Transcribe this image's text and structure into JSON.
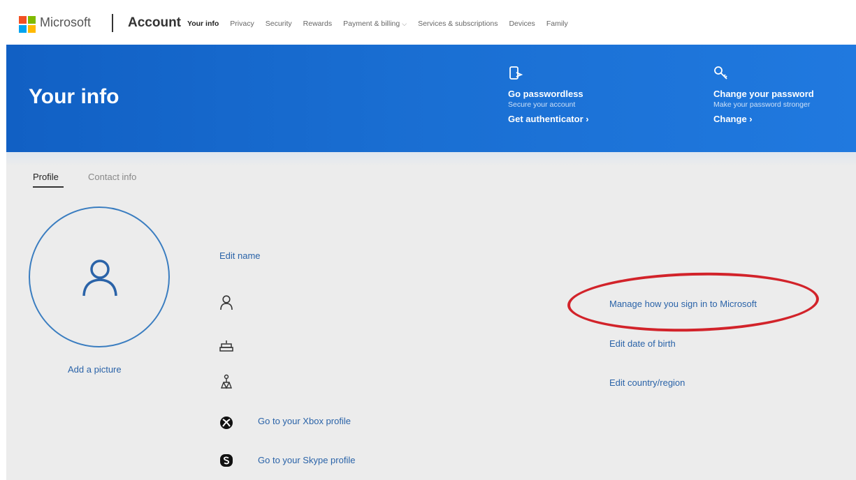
{
  "header": {
    "brand": "Microsoft",
    "product": "Account",
    "nav": [
      {
        "label": "Your info",
        "active": true
      },
      {
        "label": "Privacy"
      },
      {
        "label": "Security"
      },
      {
        "label": "Rewards"
      },
      {
        "label": "Payment & billing",
        "has_dropdown": true
      },
      {
        "label": "Services & subscriptions"
      },
      {
        "label": "Devices"
      },
      {
        "label": "Family"
      }
    ],
    "dropdown_glyph": "⌵"
  },
  "banner": {
    "title": "Your info",
    "promos": [
      {
        "icon": "passwordless-phone-icon",
        "title": "Go passwordless",
        "subtitle": "Secure your account",
        "link": "Get authenticator ›"
      },
      {
        "icon": "key-icon",
        "title": "Change your password",
        "subtitle": "Make your password stronger",
        "link": "Change ›"
      }
    ]
  },
  "tabs": {
    "profile": "Profile",
    "contact_info": "Contact info"
  },
  "profile": {
    "add_picture": "Add a picture",
    "edit_name": "Edit name",
    "xbox_link": "Go to your Xbox profile",
    "skype_link": "Go to your Skype profile"
  },
  "actions": {
    "manage_sign_in": "Manage how you sign in to Microsoft",
    "edit_dob": "Edit date of birth",
    "edit_country": "Edit country/region"
  },
  "colors": {
    "banner": "#1a6fd3",
    "link": "#2a63a8",
    "highlight": "#d2232a"
  }
}
